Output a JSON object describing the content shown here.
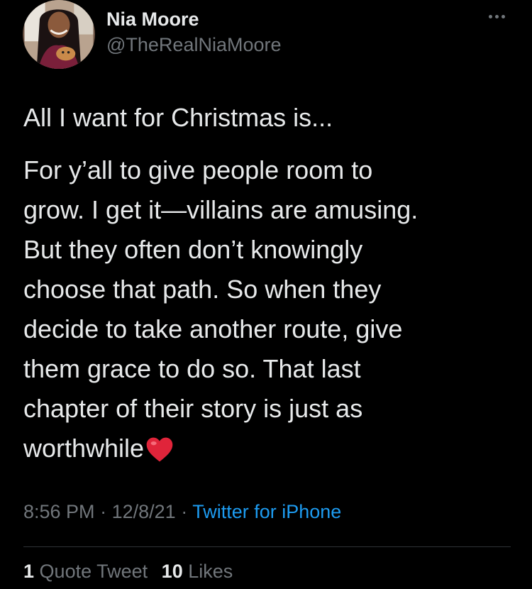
{
  "tweet": {
    "author": {
      "display_name": "Nia Moore",
      "handle": "@TheRealNiaMoore",
      "avatar": "profile-photo"
    },
    "first_line": "All I want for Christmas is...",
    "body_lines": [
      "For y’all to give people room to",
      "grow. I get it—villains are amusing.",
      "But they often don’t knowingly",
      "choose that path. So when they",
      "decide to take another route, give",
      "them grace to do so. That last",
      "chapter of their story is just as",
      "worthwhile"
    ],
    "emoji": "red-heart",
    "time": "8:56 PM",
    "date": "12/8/21",
    "separator": "·",
    "source": "Twitter for iPhone",
    "stats": {
      "quote_tweets_count": "1",
      "quote_tweets_label": "Quote Tweet",
      "likes_count": "10",
      "likes_label": "Likes"
    }
  },
  "colors": {
    "background": "#000000",
    "text_primary": "#e7e9ea",
    "text_secondary": "#71767b",
    "link": "#1d9bf0",
    "divider": "#2f3336",
    "heart": "#e0243a"
  }
}
